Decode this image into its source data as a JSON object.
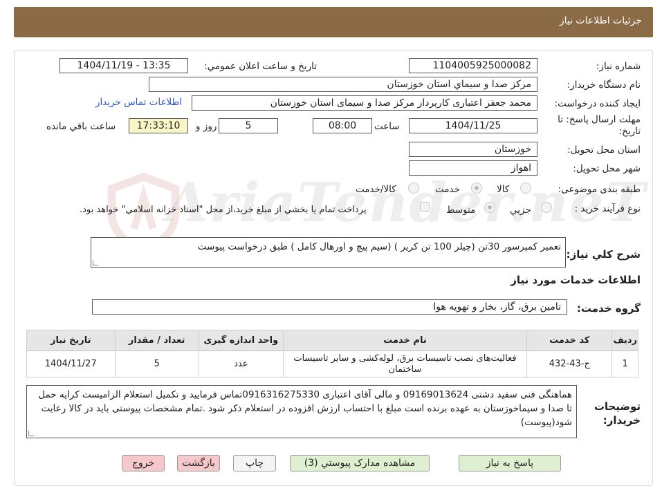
{
  "header": {
    "title": "جزئیات اطلاعات نیاز"
  },
  "fields": {
    "need_number_label": "شماره نياز:",
    "need_number": "1104005925000082",
    "announce_label": "تاريخ و ساعت اعلان عمومي:",
    "announce_value": "1404/11/19 - 13:35",
    "buyer_org_label": "نام دستگاه خريدار:",
    "buyer_org": "مرکز صدا و سيماي استان خوزستان",
    "requester_label": "ايجاد کننده درخواست:",
    "requester": "محمد جعفر اعتباری کارپرداز مرکز صدا و سیمای استان خوزستان",
    "contact_link": "اطلاعات تماس خريدار",
    "deadline_label": "مهلت ارسال پاسخ: تا تاريخ:",
    "deadline_date": "1404/11/25",
    "time_word": "ساعت",
    "deadline_time": "08:00",
    "days_value": "5",
    "days_word": "روز و",
    "remaining_time": "17:33:10",
    "remaining_word": "ساعت باقي مانده",
    "province_label": "استان محل تحويل:",
    "province": "خوزستان",
    "city_label": "شهر محل تحويل:",
    "city": "اهواز",
    "category_label": "طبقه بندی موضوعی:",
    "category_options": [
      "کالا",
      "خدمت",
      "کالا/خدمت"
    ],
    "process_label": "نوع فرآيند خريد :",
    "process_options": [
      "جزيي",
      "متوسط"
    ],
    "payment_note": "پرداخت تمام يا بخشي از مبلغ خريد،از محل \"اسناد خزانه اسلامي\" خواهد بود.",
    "summary_label": "شرح کلي نياز:",
    "summary": "تعمیر کمپرسور 30تن (چیلر 100 تن کریر ) (سیم پیچ و اورهال کامل ) طبق درخواست پیوست",
    "services_title": "اطلاعات خدمات مورد نياز",
    "group_label": "گروه خدمت:",
    "group_value": "تامين برق، گاز، بخار و تهويه هوا",
    "notes_label": "توضيحات خريدار:",
    "notes": "هماهنگی فنی سفید دشتی 09169013624 و مالی آقای اعتباری 0916316275330تماس فرمایید و تکمیل استعلام الزامیست کرایه حمل تا صدا و سیماخوزستان به عهده برنده است مبلغ با احتساب ارزش افزوده در استعلام ذکر شود .تمام مشخصات پیوستی باید در کالا رعایت شود(پیوست)"
  },
  "table": {
    "headers": [
      "رديف",
      "کد خدمت",
      "نام خدمت",
      "واحد اندازه گيری",
      "تعداد / مقدار",
      "تاريخ نياز"
    ],
    "rows": [
      [
        "1",
        "ج-43-432",
        "فعالیت‌های نصب تاسیسات برق، لوله‌کشی و سایر تاسیسات ساختمان",
        "عدد",
        "5",
        "1404/11/27"
      ]
    ]
  },
  "buttons": {
    "reply": "پاسخ به نياز",
    "attachments": "مشاهده مدارک پيوستي (3)",
    "print": "چاپ",
    "back": "بازگشت",
    "exit": "خروج"
  },
  "watermark": "AriaTender.neT",
  "colors": {
    "header_bg": "#8B6A46",
    "green_button": "#dff0d0",
    "pink_button": "#f6c8cc",
    "countdown_bg": "#f8f6c7",
    "link": "#2a56c6"
  }
}
